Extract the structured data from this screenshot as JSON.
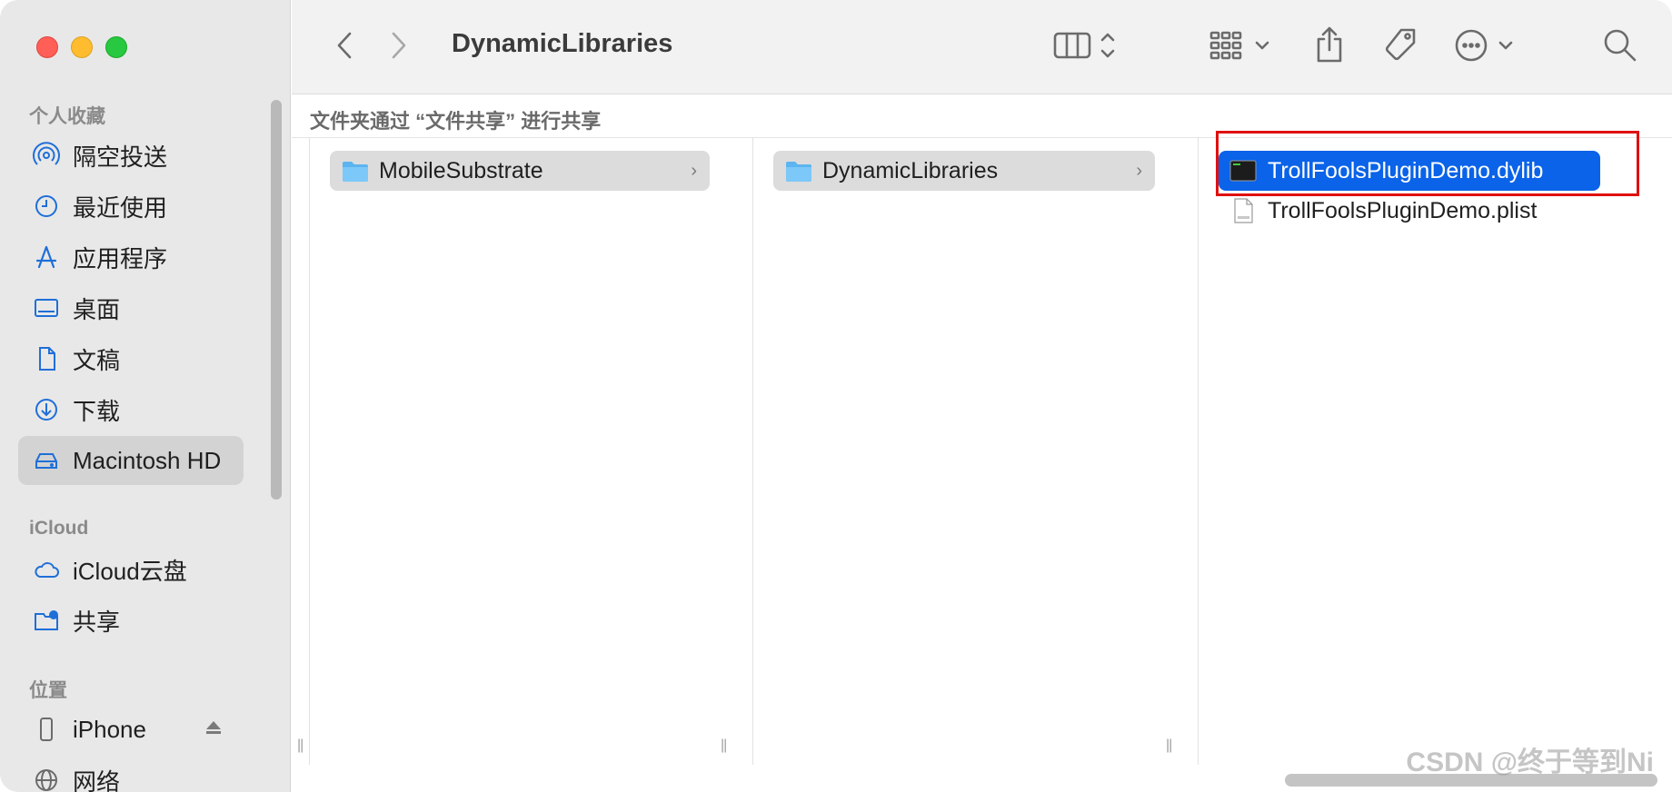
{
  "window": {
    "title": "DynamicLibraries"
  },
  "colors": {
    "accent": "#0a63e8",
    "highlight_box": "#e01010",
    "sidebar_icon": "#1f6fd8"
  },
  "sidebar": {
    "favorites_header": "个人收藏",
    "favorites": [
      {
        "label": "隔空投送",
        "icon": "airdrop-icon"
      },
      {
        "label": "最近使用",
        "icon": "clock-icon"
      },
      {
        "label": "应用程序",
        "icon": "applications-icon"
      },
      {
        "label": "桌面",
        "icon": "desktop-icon"
      },
      {
        "label": "文稿",
        "icon": "document-icon"
      },
      {
        "label": "下载",
        "icon": "download-icon"
      },
      {
        "label": "Macintosh HD",
        "icon": "harddrive-icon"
      }
    ],
    "icloud_header": "iCloud",
    "icloud": [
      {
        "label": "iCloud云盘",
        "icon": "cloud-icon"
      },
      {
        "label": "共享",
        "icon": "shared-folder-icon"
      }
    ],
    "locations_header": "位置",
    "locations": [
      {
        "label": "iPhone",
        "icon": "iphone-icon"
      },
      {
        "label": "网络",
        "icon": "network-icon"
      }
    ]
  },
  "pathbar": {
    "text": "文件夹通过 “文件共享” 进行共享"
  },
  "columns": {
    "col1": {
      "label": "MobileSubstrate"
    },
    "col2": {
      "label": "DynamicLibraries"
    },
    "col3": [
      {
        "label": "TrollFoolsPluginDemo.dylib",
        "icon": "terminal-exec-icon"
      },
      {
        "label": "TrollFoolsPluginDemo.plist",
        "icon": "plist-file-icon"
      }
    ]
  },
  "watermark": "CSDN @终于等到Ni"
}
